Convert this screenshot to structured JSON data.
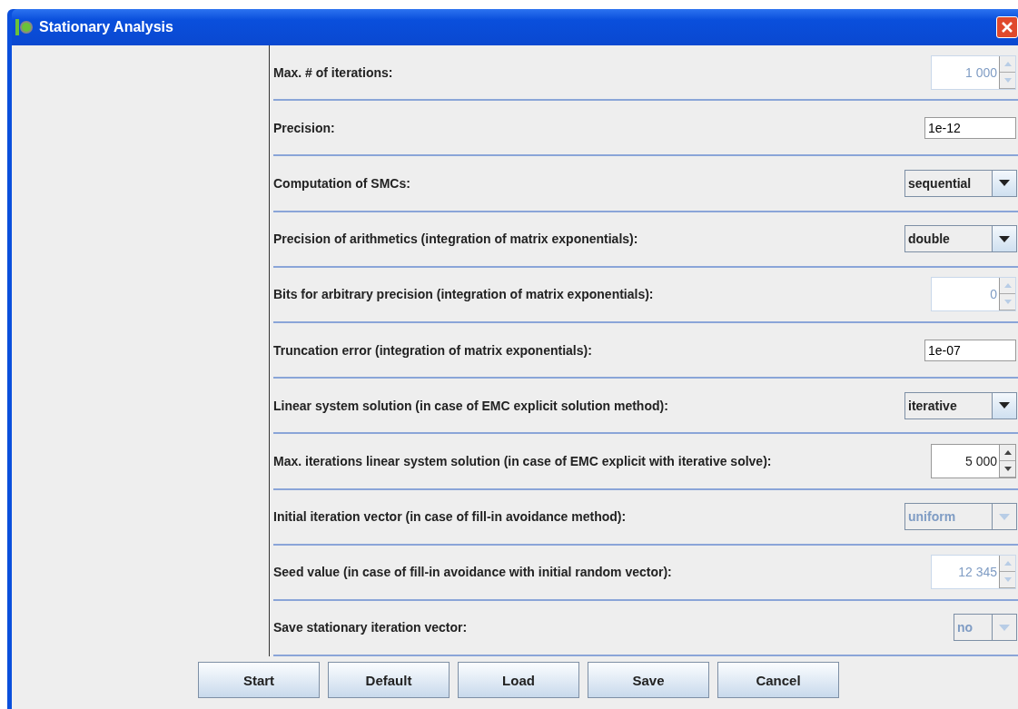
{
  "window": {
    "title": "Stationary Analysis"
  },
  "settings": [
    {
      "label": "Max. # of iterations:",
      "kind": "spinner",
      "value": "1 000",
      "disabled": true
    },
    {
      "label": "Precision:",
      "kind": "text",
      "value": "1e-12",
      "disabled": false
    },
    {
      "label": "Computation of SMCs:",
      "kind": "combo",
      "value": "sequential",
      "disabled": false
    },
    {
      "label": "Precision of arithmetics (integration of matrix exponentials):",
      "kind": "combo",
      "value": "double",
      "disabled": false
    },
    {
      "label": "Bits for arbitrary precision (integration of matrix exponentials):",
      "kind": "spinner",
      "value": "0",
      "disabled": true
    },
    {
      "label": "Truncation error (integration of matrix exponentials):",
      "kind": "text",
      "value": "1e-07",
      "disabled": false
    },
    {
      "label": "Linear system solution (in case of EMC explicit solution method):",
      "kind": "combo",
      "value": "iterative",
      "disabled": false
    },
    {
      "label": "Max. iterations linear system solution (in case of EMC explicit with iterative solve):",
      "kind": "spinner",
      "value": "5 000",
      "disabled": false
    },
    {
      "label": "Initial iteration vector (in case of fill-in avoidance method):",
      "kind": "combo",
      "value": "uniform",
      "disabled": true
    },
    {
      "label": "Seed value (in case of fill-in avoidance with initial random vector):",
      "kind": "spinner",
      "value": "12 345",
      "disabled": true
    },
    {
      "label": "Save stationary iteration vector:",
      "kind": "combo",
      "value": "no",
      "disabled": true,
      "narrow": true
    }
  ],
  "buttons": [
    "Start",
    "Default",
    "Load",
    "Save",
    "Cancel"
  ]
}
